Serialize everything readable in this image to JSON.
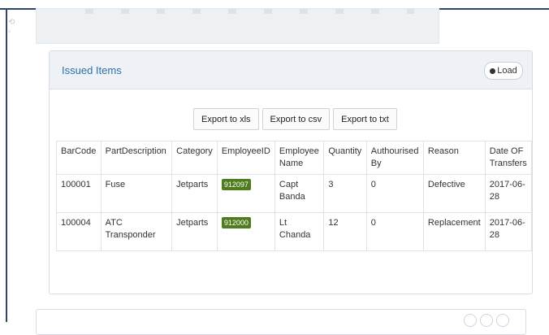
{
  "panel": {
    "title": "Issued Items",
    "load_label": "Load"
  },
  "exports": [
    "Export to xls",
    "Export to csv",
    "Export to txt"
  ],
  "table": {
    "headers": [
      "BarCode",
      "PartDescription",
      "Category",
      "EmployeeID",
      "Employee Name",
      "Quantity",
      "Authourised By",
      "Reason",
      "Date OF Transfers"
    ],
    "rows": [
      [
        "100001",
        "Fuse",
        "Jetparts",
        "912097",
        "Capt Banda",
        "3",
        "0",
        "Defective",
        "2017-06-28"
      ],
      [
        "100004",
        "ATC Transponder",
        "Jetparts",
        "912000",
        "Lt Chanda",
        "12",
        "0",
        "Replacement",
        "2017-06-28"
      ]
    ]
  },
  "colors": {
    "accent": "#2f6ea6",
    "badge": "#4f7d1e",
    "frame": "#2f4668"
  },
  "icons": {
    "load": "refresh-icon"
  }
}
